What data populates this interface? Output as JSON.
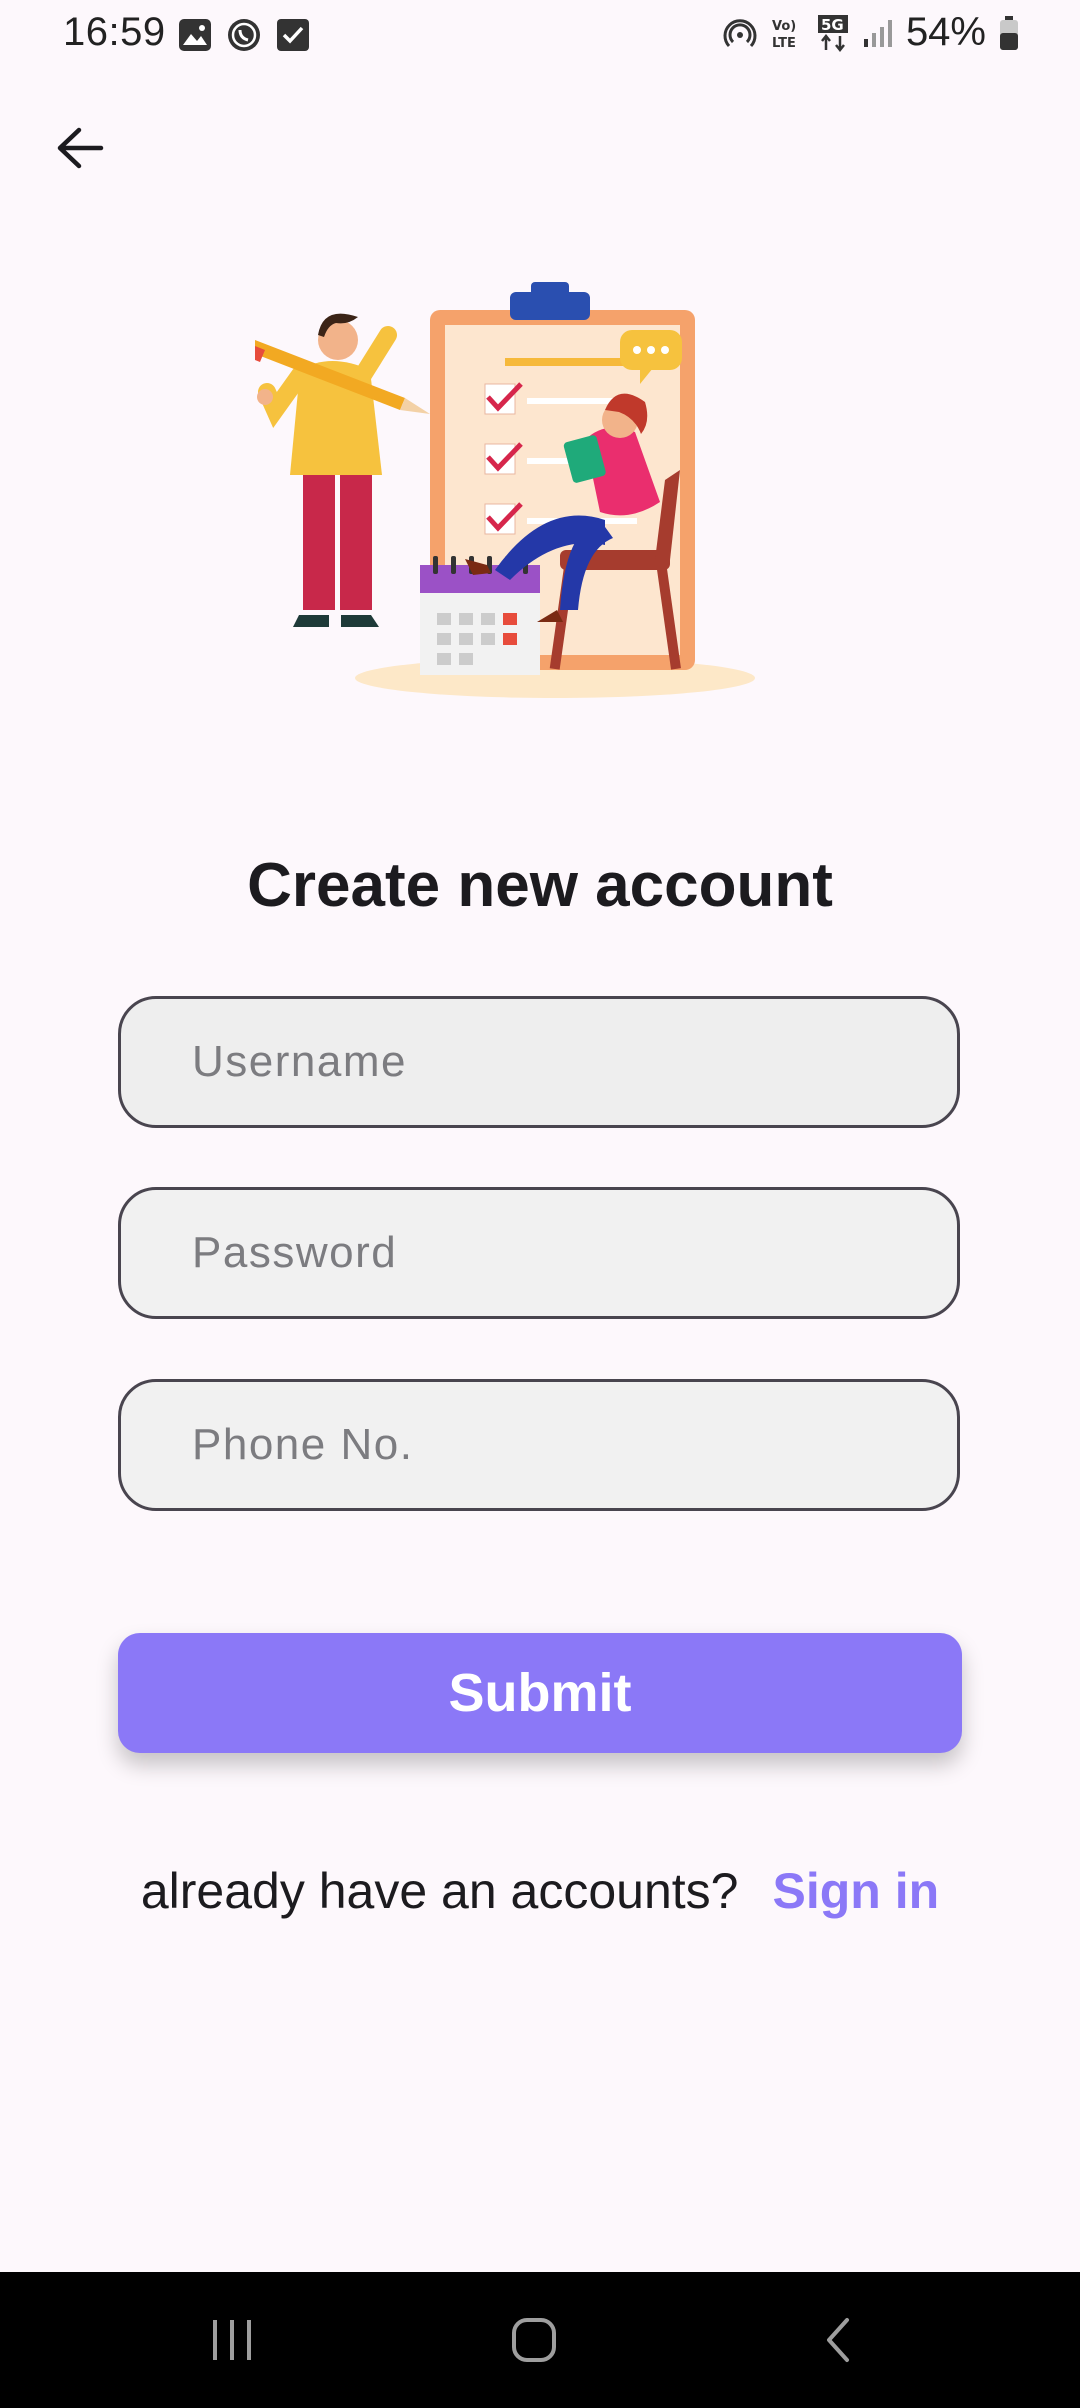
{
  "status_bar": {
    "time": "16:59",
    "battery": "54%",
    "left_icons": [
      "image-icon",
      "whatsapp-icon",
      "checkbox-icon"
    ],
    "right_icons": [
      "hotspot-icon",
      "volte-icon",
      "5g-icon",
      "signal-icon",
      "battery-icon"
    ]
  },
  "header": {
    "back_icon": "arrow-left-icon"
  },
  "page": {
    "title": "Create new account"
  },
  "form": {
    "username_placeholder": "Username",
    "password_placeholder": "Password",
    "phone_placeholder": "Phone No.",
    "submit_label": "Submit"
  },
  "footer": {
    "prompt": "already have an accounts?",
    "signin_label": "Sign in"
  },
  "colors": {
    "accent": "#8b78f7",
    "background": "#fdf8fc",
    "field_fill": "#f1f1f1",
    "field_border": "#49454f"
  },
  "nav_bar": {
    "icons": [
      "recents-icon",
      "home-icon",
      "back-nav-icon"
    ]
  }
}
